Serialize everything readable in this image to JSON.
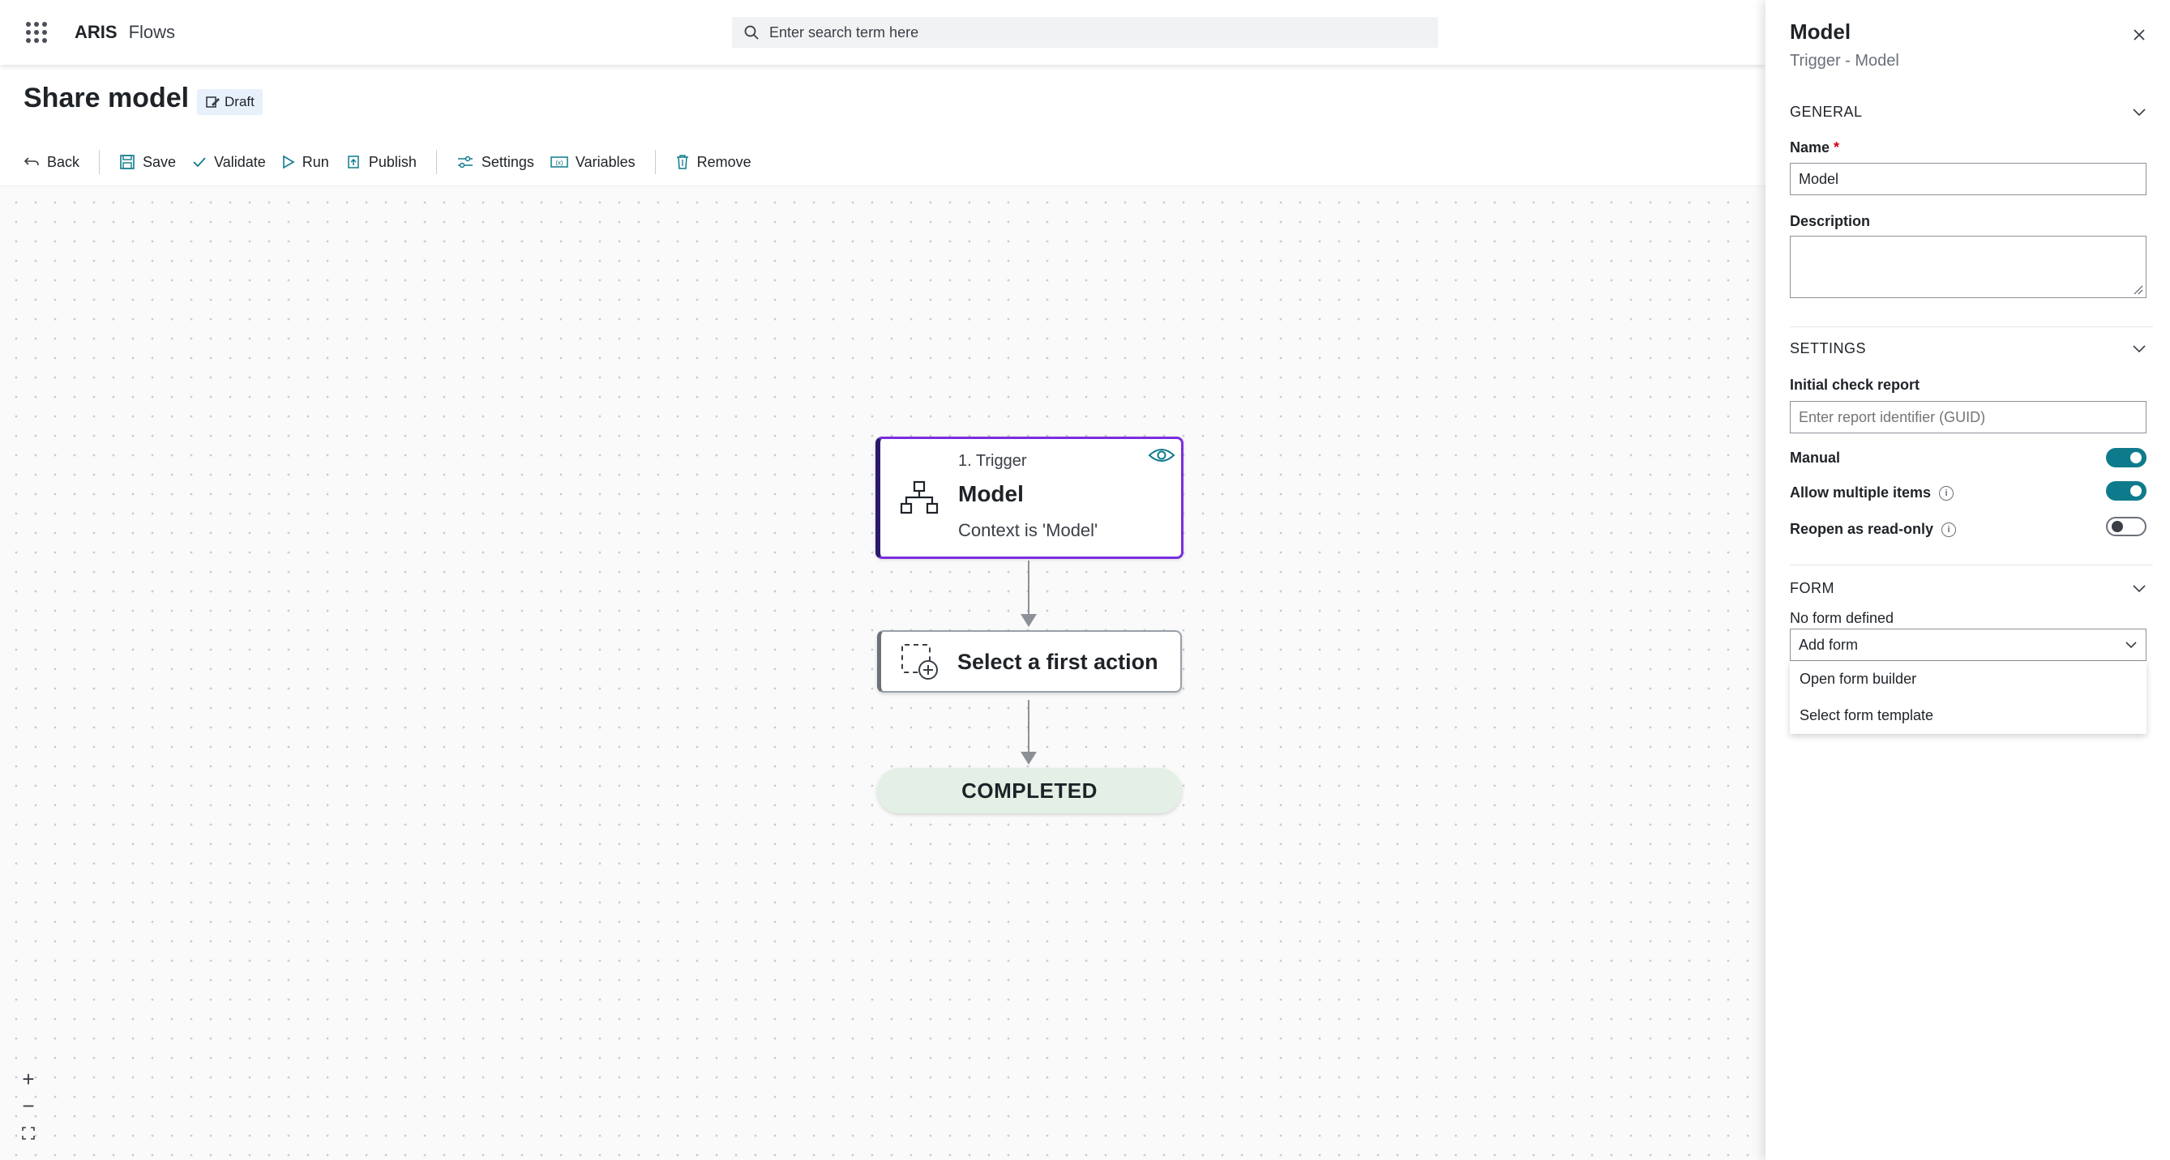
{
  "topbar": {
    "brand": "ARIS",
    "product": "Flows",
    "search_placeholder": "Enter search term here"
  },
  "page": {
    "title": "Share model",
    "status_badge": "Draft"
  },
  "toolbar": {
    "back": "Back",
    "save": "Save",
    "validate": "Validate",
    "run": "Run",
    "publish": "Publish",
    "settings": "Settings",
    "variables": "Variables",
    "remove": "Remove"
  },
  "flow": {
    "trigger": {
      "step": "1. Trigger",
      "name": "Model",
      "context": "Context is 'Model'"
    },
    "action": {
      "label": "Select a first action"
    },
    "end": {
      "label": "COMPLETED"
    }
  },
  "zoom": {
    "in": "+",
    "out": "−"
  },
  "panel": {
    "title": "Model",
    "subtitle": "Trigger - Model",
    "general": {
      "heading": "GENERAL",
      "name_label": "Name",
      "required_mark": "*",
      "name_value": "Model",
      "description_label": "Description",
      "description_value": ""
    },
    "settings": {
      "heading": "SETTINGS",
      "check_report_label": "Initial check report",
      "check_report_placeholder": "Enter report identifier (GUID)",
      "manual_label": "Manual",
      "manual_on": true,
      "multiple_label": "Allow multiple items",
      "multiple_on": true,
      "readonly_label": "Reopen as read-only",
      "readonly_on": false
    },
    "form": {
      "heading": "FORM",
      "status": "No form defined",
      "select_value": "Add form",
      "options": [
        "Open form builder",
        "Select form template"
      ]
    }
  },
  "colors": {
    "accent": "#0e7b8c",
    "trigger_border": "#7a2fe0",
    "completed_bg": "#e4f0e6"
  }
}
